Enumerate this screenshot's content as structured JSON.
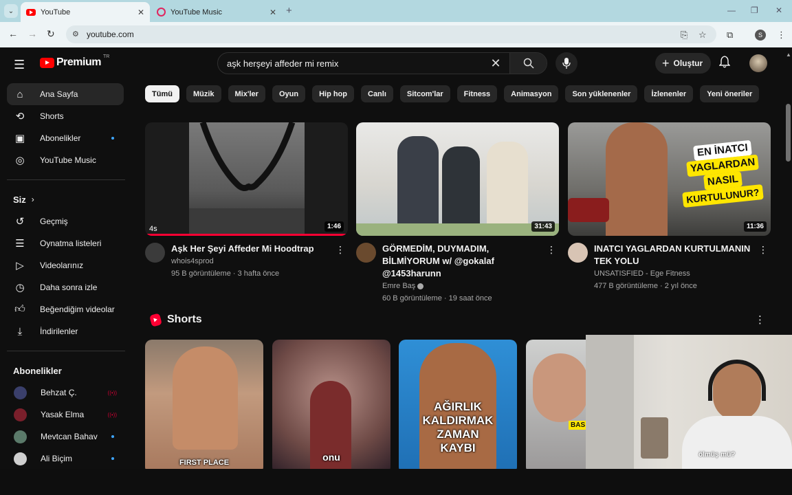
{
  "browser": {
    "tabs": [
      {
        "title": "YouTube",
        "icon": "youtube-favicon-icon",
        "active": true
      },
      {
        "title": "YouTube Music",
        "icon": "youtube-music-favicon-icon",
        "active": false
      }
    ],
    "url": "youtube.com",
    "profile_initial": "S"
  },
  "header": {
    "logo_text": "Premium",
    "logo_country": "TR",
    "search_query": "aşk herşeyi affeder mi remix",
    "create_label": "Oluştur"
  },
  "sidebar": {
    "main_items": [
      {
        "label": "Ana Sayfa",
        "icon": "home-icon",
        "active": true
      },
      {
        "label": "Shorts",
        "icon": "shorts-icon"
      },
      {
        "label": "Abonelikler",
        "icon": "subscriptions-icon",
        "dot": true
      },
      {
        "label": "YouTube Music",
        "icon": "youtube-music-icon"
      }
    ],
    "you_heading": "Siz",
    "you_items": [
      {
        "label": "Geçmiş",
        "icon": "history-icon"
      },
      {
        "label": "Oynatma listeleri",
        "icon": "playlists-icon"
      },
      {
        "label": "Videolarınız",
        "icon": "your-videos-icon"
      },
      {
        "label": "Daha sonra izle",
        "icon": "watch-later-icon"
      },
      {
        "label": "Beğendiğim videolar",
        "icon": "liked-videos-icon"
      },
      {
        "label": "İndirilenler",
        "icon": "downloads-icon"
      }
    ],
    "subs_heading": "Abonelikler",
    "subscriptions": [
      {
        "label": "Behzat Ç.",
        "status": "live",
        "color": "#3a3f6b"
      },
      {
        "label": "Yasak Elma",
        "status": "live",
        "color": "#7a1f2b"
      },
      {
        "label": "Mevtcan Bahav",
        "status": "dot",
        "color": "#5b7a6a"
      },
      {
        "label": "Ali Biçim",
        "status": "dot",
        "color": "#cfcfcf"
      }
    ]
  },
  "chips": [
    "Tümü",
    "Müzik",
    "Mix'ler",
    "Oyun",
    "Hip hop",
    "Canlı",
    "Sitcom'lar",
    "Fitness",
    "Animasyon",
    "Son yüklenenler",
    "İzlenenler",
    "Yeni öneriler"
  ],
  "videos": [
    {
      "title": "Aşk Her Şeyi Affeder Mi Hoodtrap",
      "channel": "whois4sprod",
      "stats": "95 B görüntüleme · 3 hafta önce",
      "duration": "1:46",
      "overlay_text": "4s",
      "watched_progress": 1.0,
      "verified": false
    },
    {
      "title": "GÖRMEDİM, DUYMADIM, BİLMİYORUM w/ @gokalaf @1453harunn",
      "channel": "Emre Baş",
      "stats": "60 B görüntüleme · 19 saat önce",
      "duration": "31:43",
      "verified": true
    },
    {
      "title": "INATCI YAGLARDAN KURTULMANIN TEK YOLU",
      "channel": "UNSATISFIED - Ege Fitness",
      "stats": "477 B görüntüleme · 2 yıl önce",
      "duration": "11:36",
      "verified": false,
      "thumb_lines": [
        "EN İNATCI",
        "YAGLARDAN",
        "NASIL",
        "KURTULUNUR?"
      ]
    }
  ],
  "shorts_section": {
    "title": "Shorts",
    "items": [
      {
        "caption": "FIRST PLACE"
      },
      {
        "caption": "onu"
      },
      {
        "caption_lines": [
          "AĞIRLIK",
          "KALDIRMAK",
          "ZAMAN",
          "KAYBI"
        ]
      },
      {
        "caption": "BAS"
      }
    ]
  },
  "webcam_overlay": {
    "caption": "ölmüş mü?"
  },
  "colors": {
    "background": "#0f0f0f",
    "accent_red": "#ff0033",
    "chip_bg": "#272727"
  }
}
